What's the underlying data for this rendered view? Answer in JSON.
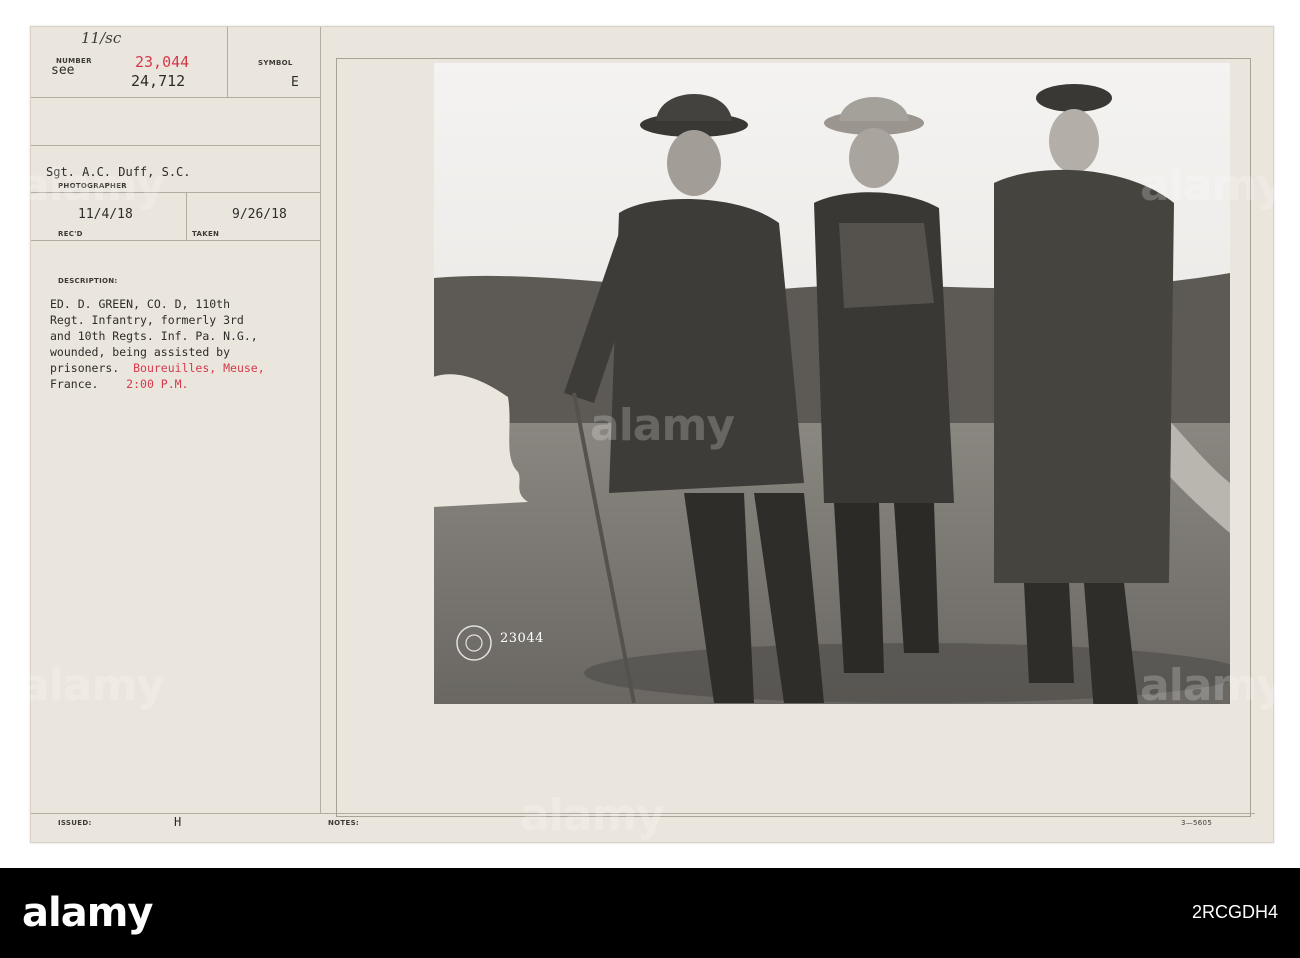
{
  "record": {
    "number_label": "NUMBER",
    "see_label": "see",
    "handwritten_note": "11/sc",
    "number_primary": "23,044",
    "number_secondary": "24,712",
    "symbol_label": "SYMBOL",
    "symbol_value": "E",
    "photographer_name": "Sgt. A.C. Duff, S.C.",
    "photographer_label": "PHOTOGRAPHER",
    "received_date": "11/4/18",
    "received_label": "REC'D",
    "taken_date": "9/26/18",
    "taken_label": "TAKEN",
    "description_label": "DESCRIPTION:",
    "description_lines": [
      "ED. D. GREEN, CO. D, 110th",
      "Regt. Infantry, formerly 3rd",
      "and 10th Regts. Inf. Pa. N.G.,",
      "wounded, being assisted by"
    ],
    "description_line5_a": "prisoners.",
    "description_place": "Boureuilles, Meuse,",
    "description_line6_a": "France.",
    "description_time": "2:00 P.M.",
    "issued_label": "ISSUED:",
    "issued_value": "H",
    "notes_label": "NOTES:",
    "form_code": "3—5605",
    "stamp_number": "23044"
  },
  "watermark": {
    "logo": "alamy",
    "image_id": "2RCGDH4"
  },
  "colors": {
    "card_background": "#ebe6dd",
    "red_typed": "#d33a4c",
    "watermark_bar": "#000000"
  }
}
